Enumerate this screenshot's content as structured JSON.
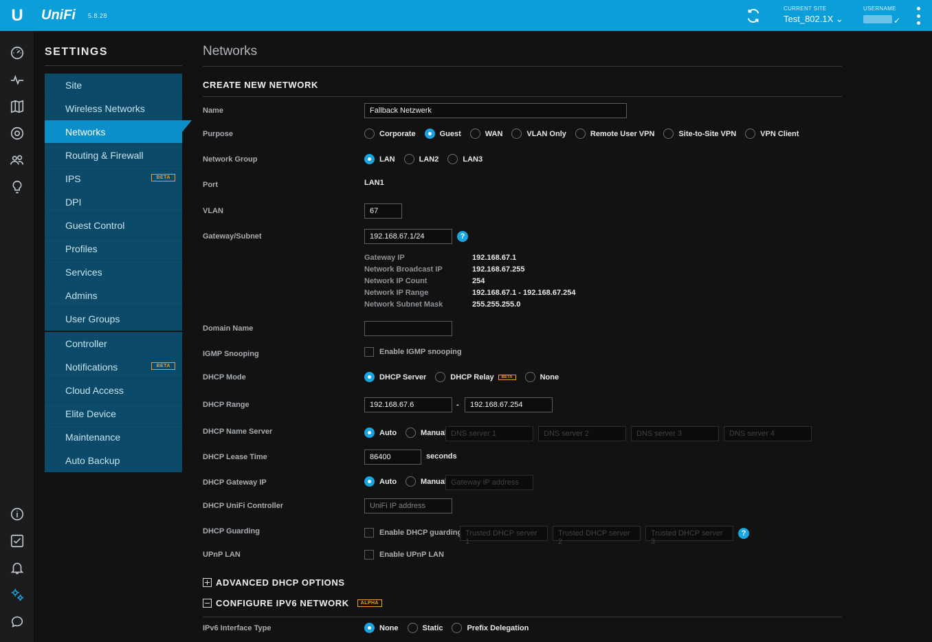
{
  "topbar": {
    "logo": "U",
    "brand": "UniFi",
    "version": "5.8.28",
    "current_site_label": "CURRENT SITE",
    "current_site": "Test_802.1X",
    "username_label": "USERNAME"
  },
  "rail": [
    "dashboard-icon",
    "statistics-icon",
    "map-icon",
    "devices-icon",
    "clients-icon",
    "insights-icon",
    "info-icon",
    "tasks-icon",
    "alerts-icon",
    "settings-icon",
    "chat-icon"
  ],
  "settings": {
    "title": "SETTINGS",
    "group1": [
      {
        "label": "Site"
      },
      {
        "label": "Wireless Networks"
      },
      {
        "label": "Networks"
      },
      {
        "label": "Routing & Firewall"
      },
      {
        "label": "IPS",
        "badge": "BETA"
      },
      {
        "label": "DPI"
      },
      {
        "label": "Guest Control"
      },
      {
        "label": "Profiles"
      },
      {
        "label": "Services"
      },
      {
        "label": "Admins"
      },
      {
        "label": "User Groups"
      }
    ],
    "group2": [
      {
        "label": "Controller"
      },
      {
        "label": "Notifications",
        "badge": "BETA"
      },
      {
        "label": "Cloud Access"
      },
      {
        "label": "Elite Device"
      },
      {
        "label": "Maintenance"
      },
      {
        "label": "Auto Backup"
      }
    ]
  },
  "page": {
    "title": "Networks",
    "section": "CREATE NEW NETWORK",
    "labels": {
      "name": "Name",
      "purpose": "Purpose",
      "network_group": "Network Group",
      "port": "Port",
      "vlan": "VLAN",
      "gateway_subnet": "Gateway/Subnet",
      "domain_name": "Domain Name",
      "igmp": "IGMP Snooping",
      "dhcp_mode": "DHCP Mode",
      "dhcp_range": "DHCP Range",
      "dhcp_name_server": "DHCP Name Server",
      "dhcp_lease": "DHCP Lease Time",
      "dhcp_gateway": "DHCP Gateway IP",
      "dhcp_unifi": "DHCP UniFi Controller",
      "dhcp_guarding": "DHCP Guarding",
      "upnp": "UPnP LAN",
      "ipv6_type": "IPv6 Interface Type"
    },
    "name_value": "Fallback Netzwerk",
    "purpose_options": [
      "Corporate",
      "Guest",
      "WAN",
      "VLAN Only",
      "Remote User VPN",
      "Site-to-Site VPN",
      "VPN Client"
    ],
    "purpose_selected": "Guest",
    "group_options": [
      "LAN",
      "LAN2",
      "LAN3"
    ],
    "group_selected": "LAN",
    "port_value": "LAN1",
    "vlan_value": "67",
    "gateway_value": "192.168.67.1/24",
    "help_glyph": "?",
    "info": {
      "gateway_ip_k": "Gateway IP",
      "gateway_ip_v": "192.168.67.1",
      "broadcast_k": "Network Broadcast IP",
      "broadcast_v": "192.168.67.255",
      "count_k": "Network IP Count",
      "count_v": "254",
      "range_k": "Network IP Range",
      "range_v": "192.168.67.1 - 192.168.67.254",
      "mask_k": "Network Subnet Mask",
      "mask_v": "255.255.255.0"
    },
    "domain_value": "",
    "igmp_label": "Enable IGMP snooping",
    "dhcp_mode_options": [
      "DHCP Server",
      "DHCP Relay",
      "None"
    ],
    "dhcp_relay_badge": "BETA",
    "dhcp_start": "192.168.67.6",
    "range_dash": "-",
    "dhcp_end": "192.168.67.254",
    "auto_label": "Auto",
    "manual_label": "Manual",
    "dns_placeholders": [
      "DNS server 1",
      "DNS server 2",
      "DNS server 3",
      "DNS server 4"
    ],
    "lease_value": "86400",
    "lease_unit": "seconds",
    "gateway_placeholder": "Gateway IP address",
    "unifi_placeholder": "UniFi IP address",
    "guarding_label": "Enable DHCP guarding",
    "trusted_placeholders": [
      "Trusted DHCP server 1",
      "Trusted DHCP server 2",
      "Trusted DHCP server 3"
    ],
    "upnp_label": "Enable UPnP LAN",
    "advanced_title": "ADVANCED DHCP OPTIONS",
    "ipv6_title": "CONFIGURE IPV6 NETWORK",
    "ipv6_badge": "ALPHA",
    "ipv6_options": [
      "None",
      "Static",
      "Prefix Delegation"
    ]
  }
}
